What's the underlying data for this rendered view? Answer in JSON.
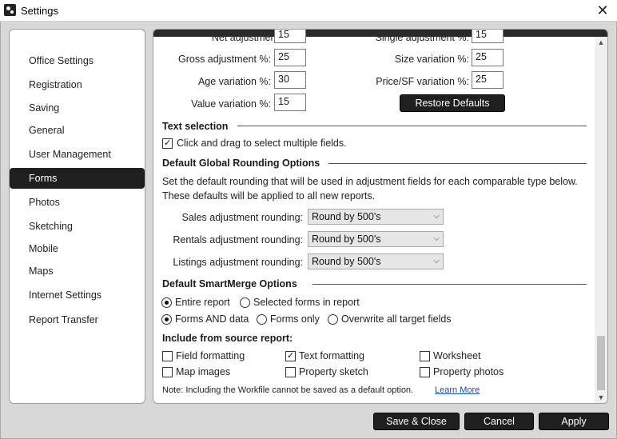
{
  "window": {
    "title": "Settings"
  },
  "sidebar": {
    "items": [
      {
        "label": "Office Settings"
      },
      {
        "label": "Registration"
      },
      {
        "label": "Saving"
      },
      {
        "label": "General"
      },
      {
        "label": "User Management"
      },
      {
        "label": "Forms"
      },
      {
        "label": "Photos"
      },
      {
        "label": "Sketching"
      },
      {
        "label": "Mobile"
      },
      {
        "label": "Maps"
      },
      {
        "label": "Internet Settings"
      },
      {
        "label": "Report Transfer"
      }
    ],
    "active": "Forms"
  },
  "adjustments": {
    "net_label": "Net adjustment %:",
    "net_value": "15",
    "single_label": "Single adjustment %:",
    "single_value": "15",
    "gross_label": "Gross adjustment %:",
    "gross_value": "25",
    "size_label": "Size variation %:",
    "size_value": "25",
    "age_label": "Age variation %:",
    "age_value": "30",
    "price_sf_label": "Price/SF variation %:",
    "price_sf_value": "25",
    "value_label": "Value variation %:",
    "value_value": "15",
    "restore_label": "Restore Defaults"
  },
  "text_selection": {
    "title": "Text selection",
    "checkbox_label": "Click and drag to select multiple fields.",
    "checked": true
  },
  "rounding": {
    "title": "Default Global Rounding Options",
    "desc1": "Set the default rounding that will be used in adjustment fields for each comparable type below.",
    "desc2": "These defaults will be applied to all new reports.",
    "sales_label": "Sales adjustment rounding:",
    "sales_value": "Round by 500's",
    "rentals_label": "Rentals adjustment rounding:",
    "rentals_value": "Round by 500's",
    "listings_label": "Listings adjustment rounding:",
    "listings_value": "Round by 500's"
  },
  "smartmerge": {
    "title": "Default SmartMerge Options",
    "entire_report": "Entire report",
    "selected_forms": "Selected forms in report",
    "forms_and_data": "Forms AND data",
    "forms_only": "Forms only",
    "overwrite": "Overwrite all target fields",
    "include_title": "Include from source report:",
    "field_formatting": "Field formatting",
    "text_formatting": "Text formatting",
    "worksheet": "Worksheet",
    "map_images": "Map images",
    "property_sketch": "Property sketch",
    "property_photos": "Property photos",
    "note": "Note: Including the Workfile cannot be saved as a default option.",
    "learn_more": "Learn More"
  },
  "footer": {
    "save_close": "Save & Close",
    "cancel": "Cancel",
    "apply": "Apply"
  }
}
